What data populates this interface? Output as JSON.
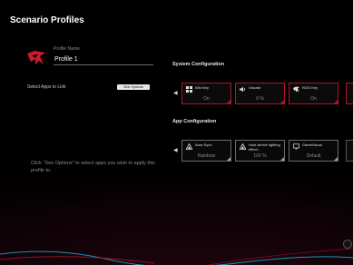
{
  "page": {
    "title": "Scenario Profiles"
  },
  "profile": {
    "name_label": "Profile Name",
    "name_value": "Profile 1"
  },
  "apps": {
    "label": "Select Apps to Link",
    "see_options": "See Options",
    "hint": "Click \"See Options\" to select apps you wish to apply this profile to."
  },
  "system_config": {
    "title": "System Configuration",
    "cards": [
      {
        "title": "Win Key",
        "value": "On",
        "icon": "windows-icon"
      },
      {
        "title": "Volume",
        "value": "0 %",
        "icon": "volume-icon"
      },
      {
        "title": "ROG Key",
        "value": "On",
        "icon": "rog-key-icon"
      }
    ]
  },
  "app_config": {
    "title": "App Configuration",
    "cards": [
      {
        "title": "Aura Sync",
        "value": "Rainbow",
        "icon": "aura-icon"
      },
      {
        "title": "Host device lighting effect...",
        "value": "100 %",
        "icon": "aura-icon"
      },
      {
        "title": "GameVisual",
        "value": "Default",
        "icon": "gamevisual-icon"
      }
    ]
  },
  "colors": {
    "accent_red": "#b5122a",
    "accent_cyan": "#1ea8d8",
    "background": "#000000"
  }
}
